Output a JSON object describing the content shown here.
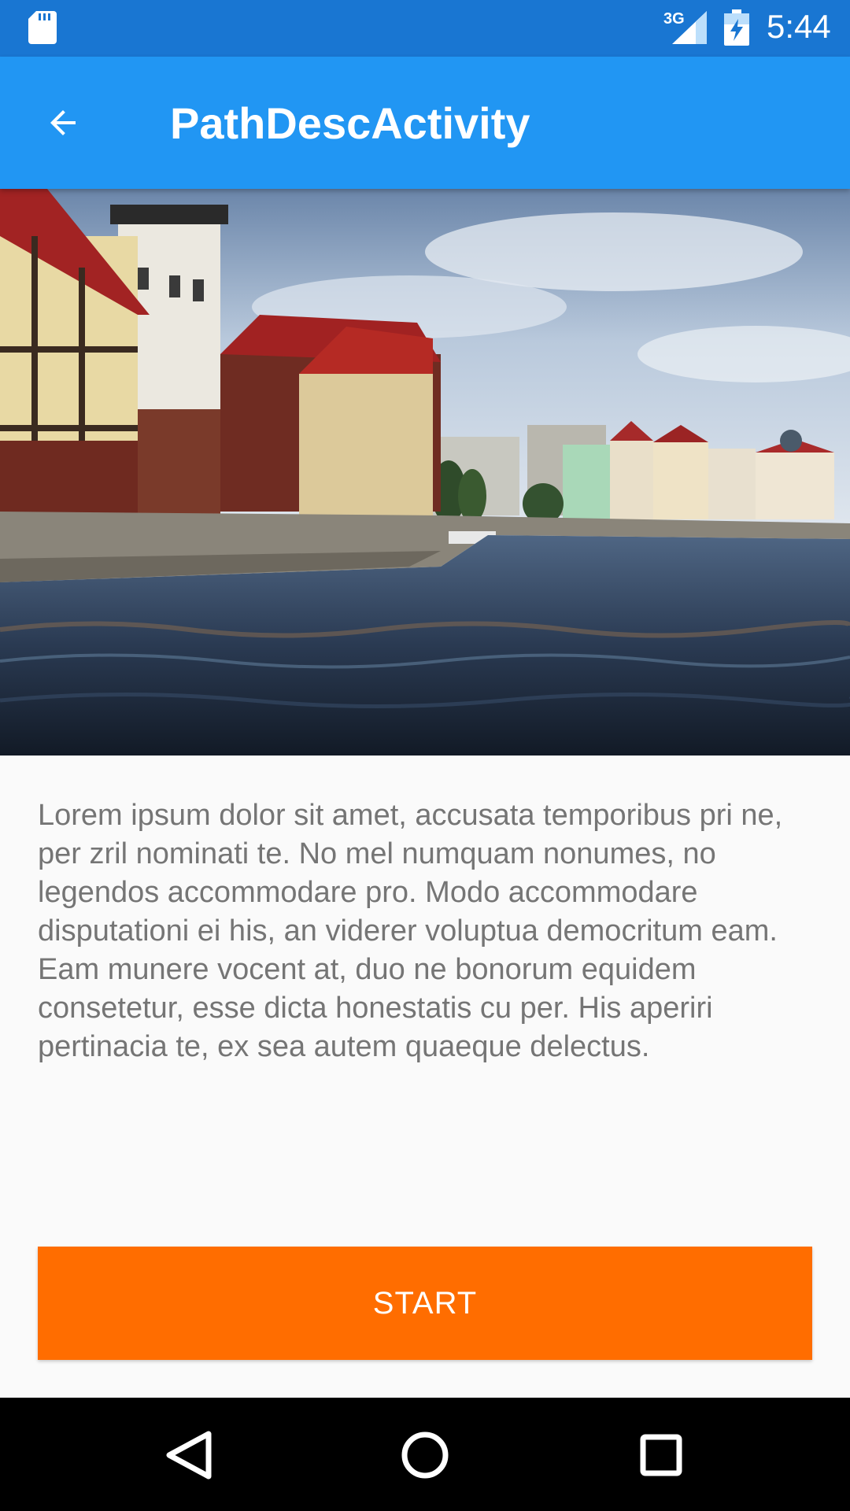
{
  "status_bar": {
    "time": "5:44",
    "network_label": "3G",
    "icons": [
      "sd-card-icon",
      "signal-icon",
      "battery-charging-icon"
    ]
  },
  "app_bar": {
    "title": "PathDescActivity",
    "back_icon": "arrow-back-icon"
  },
  "hero_image": {
    "subject": "waterfront buildings along a river"
  },
  "description": {
    "text": "Lorem ipsum dolor sit amet, accusata temporibus pri ne, per zril nominati te. No mel numquam nonumes, no legendos accommodare pro. Modo accommodare disputationi ei his, an viderer voluptua democritum eam. Eam munere vocent at, duo ne bonorum equidem consetetur, esse dicta honestatis cu per. His aperiri pertinacia te, ex sea autem quaeque delectus."
  },
  "start_button": {
    "label": "START"
  },
  "nav_bar": {
    "icons": [
      "nav-back-icon",
      "nav-home-icon",
      "nav-recents-icon"
    ]
  },
  "colors": {
    "status_bar": "#1976d2",
    "app_bar": "#2196f3",
    "accent": "#ff6d00",
    "text_secondary": "#757575",
    "background": "#fafafa"
  }
}
